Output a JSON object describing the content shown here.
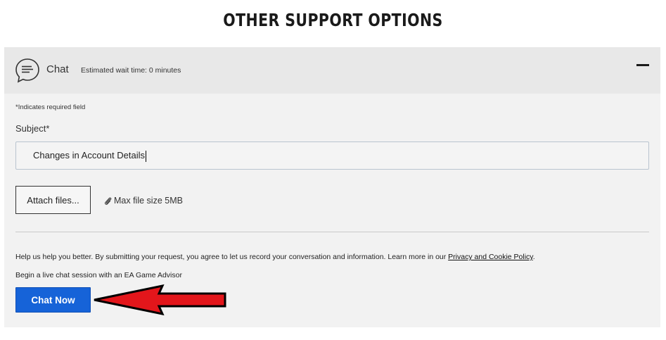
{
  "page": {
    "title": "OTHER SUPPORT OPTIONS"
  },
  "chat_panel": {
    "icon": "chat-bubble-icon",
    "title": "Chat",
    "wait_time": "Estimated wait time: 0 minutes",
    "collapse_icon": "minus-icon",
    "required_note": "*Indicates required field",
    "subject_label": "Subject*",
    "subject_value": "Changes in Account Details",
    "attach_label": "Attach files...",
    "max_size_icon": "paperclip-icon",
    "max_size": "Max file size 5MB",
    "consent_text": "Help us help you better. By submitting your request, you agree to let us record your conversation and information. Learn more in our ",
    "consent_link": "Privacy and Cookie Policy",
    "consent_end": ".",
    "begin_text": "Begin a live chat session with an EA Game Advisor",
    "chat_now_label": "Chat Now"
  },
  "annotation": {
    "icon": "red-arrow-icon",
    "color": "#e3161b"
  },
  "colors": {
    "accent": "#1663d8",
    "panel_bg": "#f2f2f2",
    "header_bg": "#e8e8e8"
  }
}
